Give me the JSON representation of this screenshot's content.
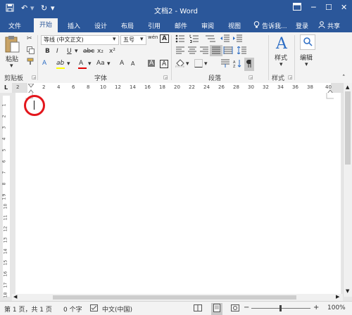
{
  "titlebar": {
    "title": "文档2 - Word",
    "undo_icon": "undo-icon",
    "redo_icon": "redo-icon",
    "save_icon": "save-icon",
    "ribbon_display_icon": "ribbon-display-options-icon",
    "min_glyph": "─",
    "max_glyph": "☐",
    "close_glyph": "✕"
  },
  "tabs": [
    "文件",
    "开始",
    "插入",
    "设计",
    "布局",
    "引用",
    "邮件",
    "审阅",
    "视图"
  ],
  "active_tab": "开始",
  "tellme": "告诉我...",
  "login": "登录",
  "share": "共享",
  "clipboard": {
    "paste": "粘贴",
    "label": "剪贴板"
  },
  "font": {
    "name": "等线 (中文正文)",
    "size": "五号",
    "grow": "A",
    "shrink": "A",
    "wen": "wén",
    "clear": "A",
    "bold": "B",
    "italic": "I",
    "underline": "U",
    "strike": "abc",
    "sub": "x₂",
    "sup": "x²",
    "effects": "A",
    "highlight": "ab",
    "color": "A",
    "case": "Aa",
    "phonetic": "A",
    "charborder": "A",
    "label": "字体"
  },
  "paragraph": {
    "label": "段落"
  },
  "styles": {
    "button": "样式",
    "label": "样式"
  },
  "editing": {
    "button": "编辑"
  },
  "ruler": {
    "left_marker": "L",
    "numbers": [
      "2",
      "2",
      "4",
      "6",
      "8",
      "10",
      "12",
      "14",
      "16",
      "18",
      "20",
      "22",
      "24",
      "26",
      "28",
      "30",
      "32",
      "34",
      "36",
      "38",
      "40"
    ],
    "v_numbers": [
      "1",
      "1",
      "2",
      "3",
      "4",
      "5",
      "6",
      "7",
      "8",
      "9",
      "10",
      "11",
      "12",
      "13",
      "14",
      "15",
      "16",
      "17",
      "18"
    ]
  },
  "status": {
    "page": "第 1 页，共 1 页",
    "words": "0 个字",
    "lang": "中文(中国)",
    "zoom": "100%",
    "zoom_minus": "−",
    "zoom_plus": "+"
  },
  "colors": {
    "brand": "#2b579a",
    "annotation_circle": "#e3161c",
    "font_color_bar": "#e00000",
    "highlight_bar": "#ffff00"
  }
}
